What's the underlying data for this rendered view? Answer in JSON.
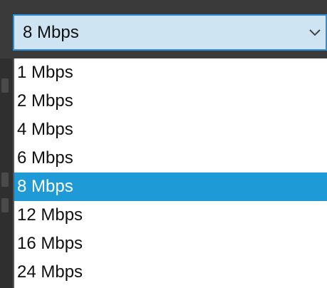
{
  "dropdown": {
    "selected_value": "8 Mbps",
    "icon": "chevron-down-icon",
    "options": [
      {
        "label": "1 Mbps",
        "selected": false
      },
      {
        "label": "2 Mbps",
        "selected": false
      },
      {
        "label": "4 Mbps",
        "selected": false
      },
      {
        "label": "6 Mbps",
        "selected": false
      },
      {
        "label": "8 Mbps",
        "selected": true
      },
      {
        "label": "12 Mbps",
        "selected": false
      },
      {
        "label": "16 Mbps",
        "selected": false
      },
      {
        "label": "24 Mbps",
        "selected": false
      }
    ]
  },
  "colors": {
    "select_bg": "#cfe4f2",
    "select_border": "#2f8fd6",
    "highlight": "#1e9bd7",
    "background": "#3a3a3a",
    "list_bg": "#ffffff"
  }
}
